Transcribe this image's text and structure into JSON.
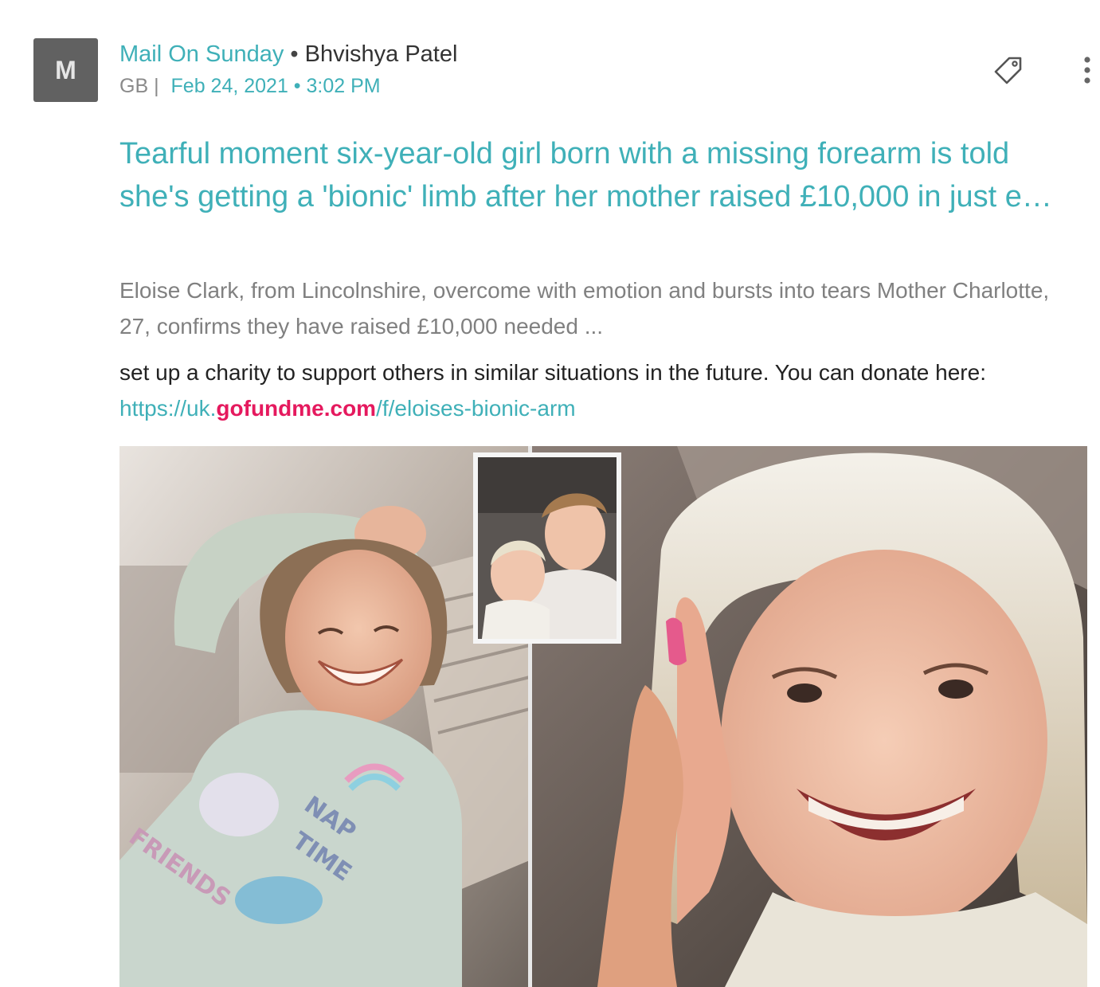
{
  "avatar": {
    "letter": "M"
  },
  "header": {
    "source": "Mail On Sunday",
    "separator": "•",
    "author": "Bhvishya Patel",
    "region": "GB |",
    "date": "Feb 24, 2021 • 3:02 PM"
  },
  "actions": {
    "tag_icon": "tag-icon",
    "more_icon": "more-vertical-icon"
  },
  "article": {
    "headline": "Tearful moment six-year-old girl born with a missing forearm is told she's getting a 'bionic' limb after her mother raised £10,000 in just e…",
    "snippet": "Eloise Clark, from Lincolnshire, overcome with emotion and bursts into tears Mother Charlotte, 27, confirms they have raised £10,000 needed ...",
    "body_prefix": "set up a charity to support others in similar situations in the future. You can donate here: ",
    "url_start": "https://uk.",
    "url_brand": "gofundme.com",
    "url_end": "/f/eloises-bionic-arm"
  },
  "image": {
    "shirt_text_1": "NAP",
    "shirt_text_2": "TIME",
    "shirt_text_3": "FRIENDS"
  }
}
